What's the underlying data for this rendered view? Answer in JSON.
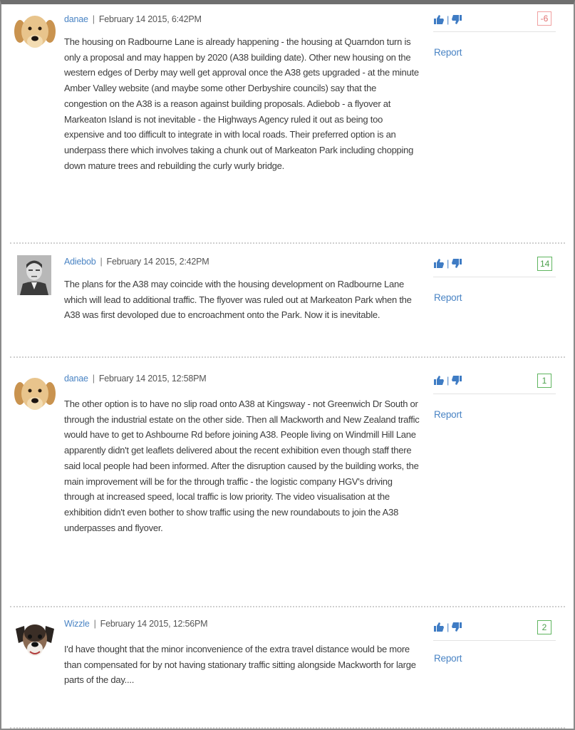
{
  "comments": [
    {
      "avatar": "labrador-puppy-avatar",
      "user": "danae",
      "date": "February 14 2015, 6:42PM",
      "body": "The housing on Radbourne Lane is already happening - the housing at Quarndon turn is only a proposal and may happen by 2020 (A38 building date). Other new housing on the western edges of Derby may well get approval once the A38 gets upgraded - at the minute Amber Valley website (and maybe some other Derbyshire councils) say that the congestion on the A38 is a reason against building proposals. Adiebob - a flyover at Markeaton Island is not inevitable - the Highways Agency ruled it out as being too expensive and too difficult to integrate in with local roads. Their preferred option is an underpass there which involves taking a chunk out of Markeaton Park including chopping down mature trees and rebuilding the curly wurly bridge.",
      "score": "-6",
      "score_negative": true,
      "report": "Report"
    },
    {
      "avatar": "man-portrait-avatar",
      "user": "Adiebob",
      "date": "February 14 2015, 2:42PM",
      "body": "The plans for the A38 may coincide with the housing development on Radbourne Lane which will lead to additional traffic. The flyover was ruled out at Markeaton Park when the A38 was first devoloped due to encroachment onto the Park. Now it is inevitable.",
      "score": "14",
      "score_negative": false,
      "report": "Report"
    },
    {
      "avatar": "labrador-puppy-avatar",
      "user": "danae",
      "date": "February 14 2015, 12:58PM",
      "body": "The other option is to have no slip road onto A38 at Kingsway - not Greenwich Dr South or through the industrial estate on the other side. Then all Mackworth and New Zealand traffic would have to get to Ashbourne Rd before joining A38. People living on Windmill Hill Lane apparently didn't get leaflets delivered about the recent exhibition even though staff there said local people had been informed. After the disruption caused by the building works, the main improvement will be for the through traffic - the logistic company HGV's driving through at increased speed, local traffic is low priority. The video visualisation at the exhibition didn't even bother to show traffic using the new roundabouts to join the A38 underpasses and flyover.",
      "score": "1",
      "score_negative": false,
      "report": "Report"
    },
    {
      "avatar": "dog-face-avatar",
      "user": "Wizzle",
      "date": "February 14 2015, 12:56PM",
      "body": "I'd have thought that the minor inconvenience of the extra travel distance would be more than compensated for by not having stationary traffic sitting alongside Mackworth for large parts of the day....",
      "score": "2",
      "score_negative": false,
      "report": "Report"
    }
  ],
  "colors": {
    "link": "#4a84c4",
    "score_positive": "#4ca04c",
    "score_negative": "#e07070"
  },
  "vote_separator": "|"
}
